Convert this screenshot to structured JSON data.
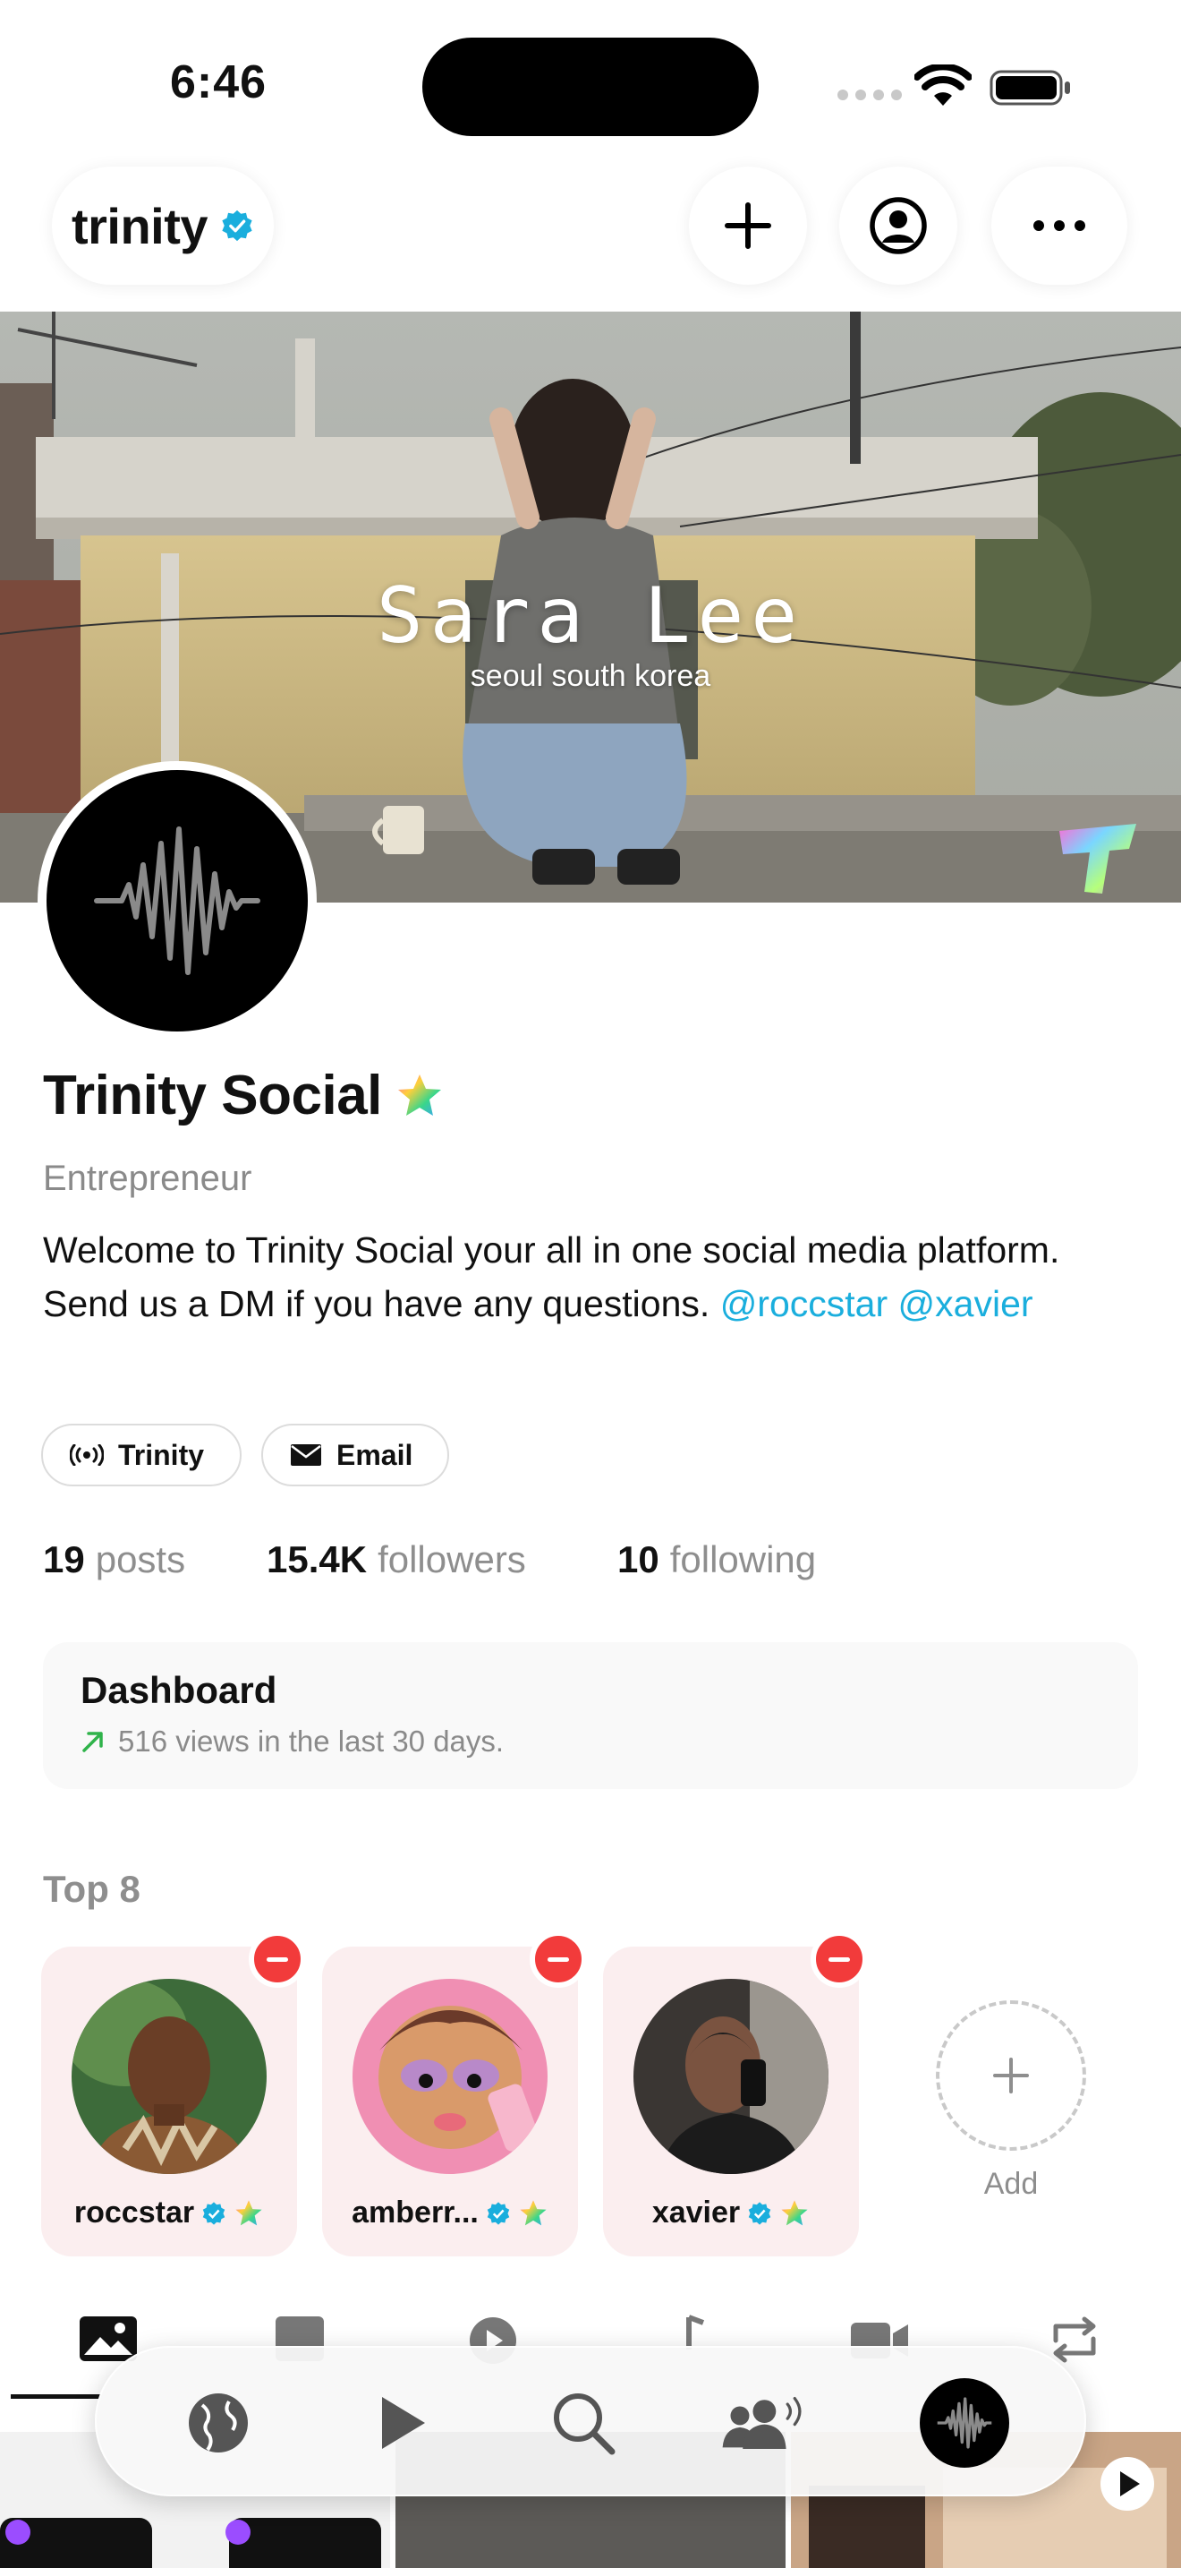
{
  "status_bar": {
    "time": "6:46"
  },
  "header": {
    "brand": "trinity",
    "icons": [
      "verified-badge-icon",
      "plus-icon",
      "account-icon",
      "more-icon"
    ]
  },
  "banner": {
    "title": "Sara Lee",
    "subtitle": "seoul south korea"
  },
  "profile": {
    "name": "Trinity Social",
    "role": "Entrepreneur",
    "bio": "Welcome to Trinity Social your all in one social media platform. Send us a DM if you have any questions.",
    "mentions": [
      "@roccstar",
      "@xavier"
    ],
    "chips": [
      {
        "label": "Trinity",
        "icon": "broadcast-icon"
      },
      {
        "label": "Email",
        "icon": "mail-icon"
      }
    ],
    "stats": {
      "posts": {
        "value": "19",
        "label": "posts"
      },
      "followers": {
        "value": "15.4K",
        "label": "followers"
      },
      "following": {
        "value": "10",
        "label": "following"
      }
    }
  },
  "dashboard": {
    "title": "Dashboard",
    "subtitle": "516 views in the last 30 days.",
    "trend_color": "#2fb34a"
  },
  "top8": {
    "title": "Top 8",
    "friends": [
      {
        "name": "roccstar"
      },
      {
        "name": "amberr..."
      },
      {
        "name": "xavier"
      }
    ],
    "add_label": "Add"
  },
  "tabs": [
    "photos-icon",
    "posts-icon",
    "videos-icon",
    "music-icon",
    "camera-icon",
    "repost-icon"
  ],
  "bottom_nav": [
    "globe-icon",
    "play-icon",
    "search-icon",
    "groups-icon",
    "profile-waveform-icon"
  ],
  "colors": {
    "accent": "#1aaedd",
    "remove": "#f23b3b",
    "card_pink": "#fbeeef"
  }
}
